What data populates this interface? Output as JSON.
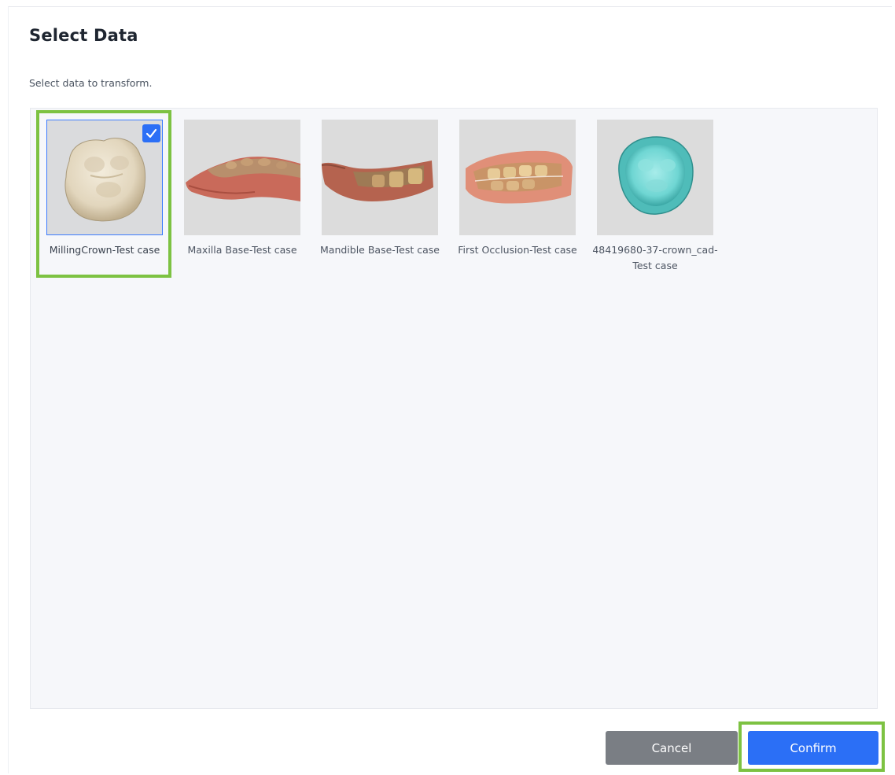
{
  "dialog": {
    "title": "Select Data",
    "subtitle": "Select data to transform."
  },
  "items": [
    {
      "label": "MillingCrown-Test case",
      "selected": true,
      "thumbnail": "crown-model-icon"
    },
    {
      "label": "Maxilla Base-Test case",
      "selected": false,
      "thumbnail": "maxilla-scan-icon"
    },
    {
      "label": "Mandible Base-Test case",
      "selected": false,
      "thumbnail": "mandible-scan-icon"
    },
    {
      "label": "First Occlusion-Test case",
      "selected": false,
      "thumbnail": "occlusion-scan-icon"
    },
    {
      "label": "48419680-37-crown_cad-Test case",
      "selected": false,
      "thumbnail": "crown-cad-icon"
    }
  ],
  "buttons": {
    "cancel": "Cancel",
    "confirm": "Confirm"
  },
  "colors": {
    "primary": "#2b6ff6",
    "cancel": "#7a7e84",
    "highlight": "#7dc242",
    "panel_background": "#f6f7fa"
  }
}
